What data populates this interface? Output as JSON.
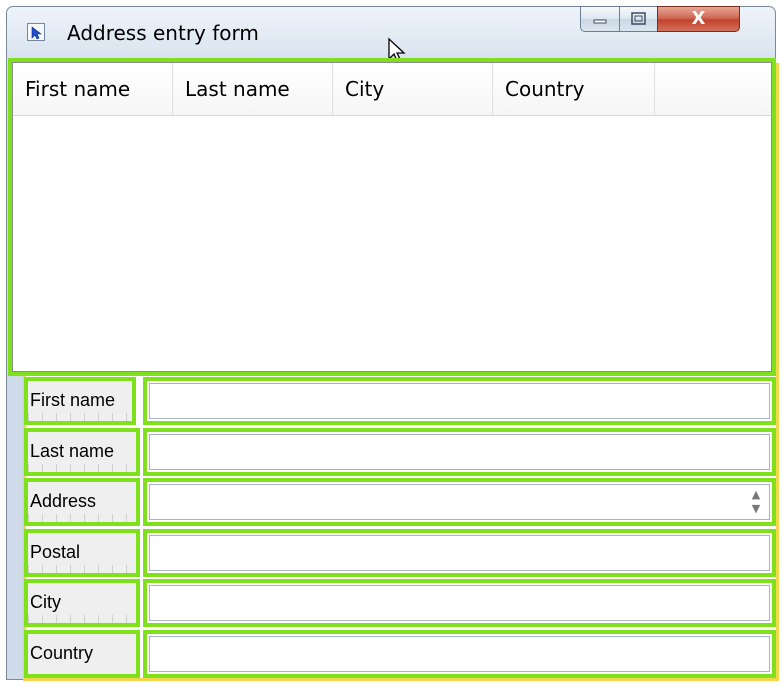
{
  "window": {
    "title": "Address entry form",
    "close_glyph": "X",
    "icons": [
      "app-icon",
      "minimize-icon",
      "maximize-icon",
      "close-icon",
      "mouse-cursor-icon"
    ]
  },
  "grid": {
    "columns": [
      "First name",
      "Last name",
      "City",
      "Country"
    ],
    "rows": []
  },
  "form": {
    "fields": [
      {
        "label": "First name",
        "value": ""
      },
      {
        "label": "Last name",
        "value": ""
      },
      {
        "label": "Address",
        "value": ""
      },
      {
        "label": "Postal",
        "value": ""
      },
      {
        "label": "City",
        "value": ""
      },
      {
        "label": "Country",
        "value": ""
      }
    ]
  },
  "colors": {
    "highlight_green": "#7fe01c",
    "highlight_yellow": "#f1d84a",
    "close_button_red": "#c1432c"
  }
}
